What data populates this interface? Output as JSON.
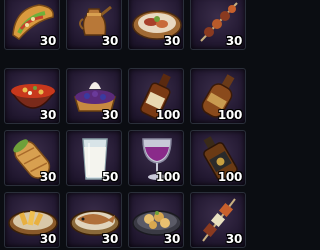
{
  "inventory": {
    "slots": [
      {
        "name": "taco-slot",
        "icon": "taco-icon",
        "qty": "30"
      },
      {
        "name": "coffee-pot-slot",
        "icon": "coffee-pot-icon",
        "qty": "30"
      },
      {
        "name": "meat-platter-slot",
        "icon": "meat-platter-icon",
        "qty": "30"
      },
      {
        "name": "skewer-slot",
        "icon": "skewer-icon",
        "qty": "30"
      },
      {
        "name": "stew-bowl-slot",
        "icon": "stew-bowl-icon",
        "qty": "30"
      },
      {
        "name": "berry-tart-slot",
        "icon": "berry-tart-icon",
        "qty": "30"
      },
      {
        "name": "brown-bottle-slot",
        "icon": "brown-bottle-icon",
        "qty": "100"
      },
      {
        "name": "round-bottle-slot",
        "icon": "round-bottle-icon",
        "qty": "100"
      },
      {
        "name": "wrap-slot",
        "icon": "wrap-icon",
        "qty": "30"
      },
      {
        "name": "milk-glass-slot",
        "icon": "milk-glass-icon",
        "qty": "50"
      },
      {
        "name": "wine-glass-slot",
        "icon": "wine-glass-icon",
        "qty": "100"
      },
      {
        "name": "whiskey-bottle-slot",
        "icon": "whiskey-bottle-icon",
        "qty": "100"
      },
      {
        "name": "fries-plate-slot",
        "icon": "fries-plate-icon",
        "qty": "30"
      },
      {
        "name": "fish-plate-slot",
        "icon": "fish-plate-icon",
        "qty": "30"
      },
      {
        "name": "dumpling-plate-slot",
        "icon": "dumpling-plate-icon",
        "qty": "30"
      },
      {
        "name": "kebab-slot",
        "icon": "kebab-icon",
        "qty": "30"
      }
    ]
  }
}
